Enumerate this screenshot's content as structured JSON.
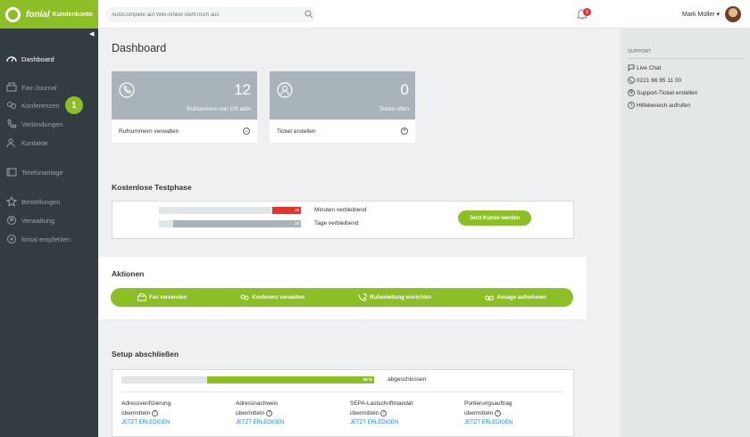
{
  "brand": {
    "name": "fonial",
    "sub": "Kundenkonto"
  },
  "colors": {
    "accent": "#8cbf26",
    "sidebar": "#333d41",
    "alert": "#e3342f",
    "link": "#2a7fd5"
  },
  "search": {
    "placeholder": "AutoComplete auf Wiki-Artikel steht noch aus"
  },
  "notifications": {
    "count": "5"
  },
  "user": {
    "name": "Mark Müller ▾"
  },
  "sidebar": {
    "items": [
      {
        "label": "Dashboard",
        "icon": "dashboard-icon"
      },
      {
        "label": "Fax-Journal",
        "icon": "fax-icon"
      },
      {
        "label": "Konferenzen",
        "icon": "conference-icon"
      },
      {
        "label": "Verbindungen",
        "icon": "phone-icon"
      },
      {
        "label": "Kontakte",
        "icon": "contacts-icon"
      },
      {
        "label": "Telefonanlage",
        "icon": "pbx-icon"
      },
      {
        "label": "Bestellungen",
        "icon": "star-icon"
      },
      {
        "label": "Verwaltung",
        "icon": "settings-icon"
      },
      {
        "label": "fonial empfehlen",
        "icon": "recommend-icon"
      }
    ],
    "step_badge": "1"
  },
  "main": {
    "title": "Dashboard",
    "cards": [
      {
        "number": "12",
        "sub": "Rufnummern von 100 aktiv",
        "action": "Rufnummern verwalten",
        "icon": "phone-icon"
      },
      {
        "number": "0",
        "sub": "Tickets offen",
        "action": "Ticket erstellen",
        "icon": "support-icon"
      }
    ],
    "trial": {
      "title": "Kostenlose Testphase",
      "minutes_value": "16",
      "minutes_label": "Minuten verbleibend",
      "minutes_fraction": 0.2,
      "days_value": "28",
      "days_label": "Tage verbleibend",
      "days_fraction": 0.9,
      "button": "Jetzt Kunde werden"
    },
    "actions": {
      "title": "Aktionen",
      "items": [
        "Fax versenden",
        "Konferenz verwalten",
        "Rufumleitung einrichten",
        "Ansage aufnehmen"
      ]
    },
    "setup": {
      "title": "Setup abschließen",
      "progress": "66 %",
      "progress_fraction": 0.66,
      "progress_label": "abgeschlossen",
      "items": [
        {
          "line1": "Adressverifizierung",
          "line2": "übermitteln",
          "link": "JETZT ERLEDIGEN"
        },
        {
          "line1": "Adressnachweis",
          "line2": "übermitteln",
          "link": "JETZT ERLEDIGEN"
        },
        {
          "line1": "SEPA-Lastschriftmandat",
          "line2": "übermitteln",
          "link": "JETZT ERLEDIGEN"
        },
        {
          "line1": "Portierungsauftrag",
          "line2": "übermitteln",
          "link": "JETZT ERLEDIGEN"
        }
      ]
    }
  },
  "support": {
    "title": "SUPPORT",
    "items": [
      "Live Chat",
      "0221 66 95 11 00",
      "Support-Ticket erstellen",
      "Hilfebereich aufrufen"
    ]
  }
}
